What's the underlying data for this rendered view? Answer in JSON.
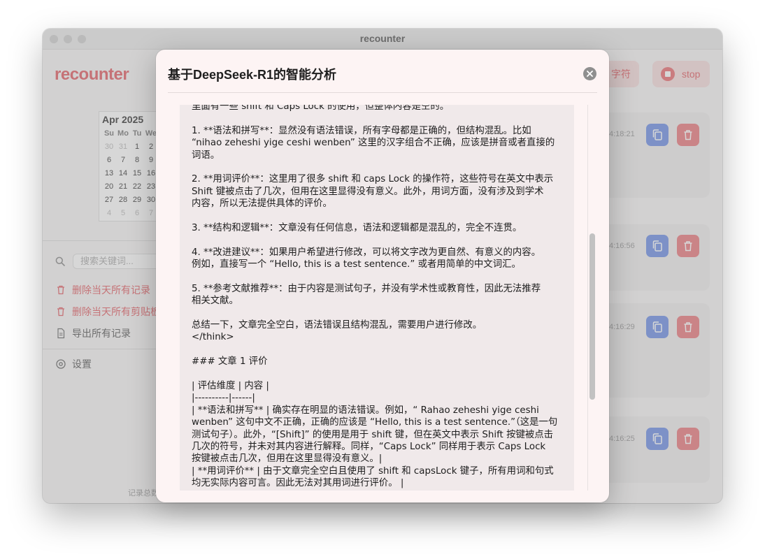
{
  "window": {
    "title": "recounter"
  },
  "app": {
    "brand": "recounter"
  },
  "calendar": {
    "month_label": "Apr 2025",
    "weekdays": [
      "Su",
      "Mo",
      "Tu",
      "We",
      ""
    ],
    "days": [
      [
        "30",
        "31",
        "1",
        "2",
        ""
      ],
      [
        "6",
        "7",
        "8",
        "9",
        ""
      ],
      [
        "13",
        "14",
        "15",
        "16",
        ""
      ],
      [
        "20",
        "21",
        "22",
        "23",
        ""
      ],
      [
        "27",
        "28",
        "29",
        "30",
        ""
      ],
      [
        "4",
        "5",
        "6",
        "7",
        ""
      ]
    ]
  },
  "sidebar": {
    "search_placeholder": "搜索关键词...",
    "delete_today_records": "删除当天所有记录",
    "delete_today_clipboard": "删除当天所有剪贴板",
    "export_all": "导出所有记录",
    "settings": "设置",
    "footer_note": "记录总数"
  },
  "toolbar": {
    "count_label": "字符",
    "stop_label": "stop"
  },
  "records": [
    {
      "time": "4:18:21"
    },
    {
      "time": "4:16:56"
    },
    {
      "time": "4:16:29"
    },
    {
      "time": "4:16:25"
    }
  ],
  "modal": {
    "title": "基于DeepSeek-R1的智能分析",
    "lines": [
      "里面有一些 shift 和 Caps Lock 的使用，但整体内容是空的。",
      "",
      "1. **语法和拼写**：显然没有语法错误，所有字母都是正确的，但结构混乱。比如",
      "“nihao zeheshi yige ceshi wenben” 这里的汉字组合不正确，应该是拼音或者直接的",
      "词语。",
      "",
      "2. **用词评价**：这里用了很多 shift 和 caps Lock 的操作符，这些符号在英文中表示",
      "Shift 键被点击了几次，但用在这里显得没有意义。此外，用词方面，没有涉及到学术",
      "内容，所以无法提供具体的评价。",
      "",
      "3. **结构和逻辑**：文章没有任何信息，语法和逻辑都是混乱的，完全不连贯。",
      "",
      "4. **改进建议**：如果用户希望进行修改，可以将文字改为更自然、有意义的内容。",
      "例如，直接写一个 “Hello, this is a test sentence.” 或者用简单的中文词汇。",
      "",
      "5. **参考文献推荐**：由于内容是测试句子，并没有学术性或教育性，因此无法推荐",
      "相关文献。",
      "",
      "总结一下，文章完全空白，语法错误且结构混乱，需要用户进行修改。",
      "</think>",
      "",
      "### 文章 1 评价",
      "",
      "| 评估维度 | 内容 |",
      "|----------|------|",
      "| **语法和拼写** | 确实存在明显的语法错误。例如，“ Rahao zeheshi yige ceshi",
      "wenben” 这句中文不正确，正确的应该是 “Hello, this is a test sentence.”（这是一句",
      "测试句子）。此外，“[Shift]” 的使用是用于 shift 键，但在英文中表示 Shift 按键被点击",
      "几次的符号，并未对其内容进行解释。同样，“Caps Lock” 同样用于表示 Caps Lock",
      "按键被点击几次，但用在这里显得没有意义。|",
      "| **用词评价** | 由于文章完全空白且使用了 shift 和 capsLock 键子，所有用词和句式",
      "均无实际内容可言。因此无法对其用词进行评价。 |"
    ]
  },
  "colors": {
    "accent": "#e35d63",
    "copy": "#6e8fe6",
    "delete": "#ea7a7e",
    "modal_bg": "#fdf4f4"
  }
}
